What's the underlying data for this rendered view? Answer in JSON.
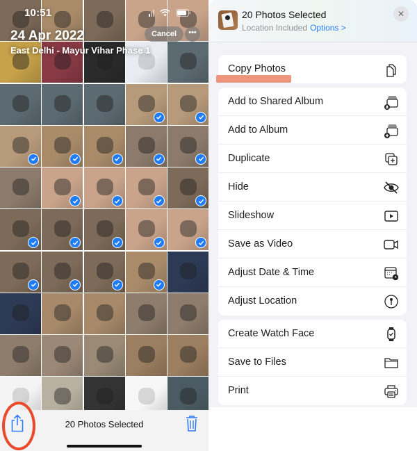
{
  "status_bar": {
    "time": "10:51"
  },
  "photos": {
    "date": "24 Apr 2022",
    "location": "East Delhi - Mayur Vihar Phase 1",
    "cancel_label": "Cancel",
    "more_label": "•••",
    "selected_count_label": "20 Photos Selected",
    "grid": [
      {
        "tone": "wood-dark",
        "selected": false
      },
      {
        "tone": "wood",
        "selected": false
      },
      {
        "tone": "wood-dark",
        "selected": false
      },
      {
        "tone": "hand",
        "selected": false
      },
      {
        "tone": "hand",
        "selected": false
      },
      {
        "tone": "poster",
        "selected": false
      },
      {
        "tone": "boxing",
        "selected": false
      },
      {
        "tone": "dark-text",
        "selected": false
      },
      {
        "tone": "chat",
        "selected": false
      },
      {
        "tone": "hose",
        "selected": false
      },
      {
        "tone": "hose",
        "selected": false
      },
      {
        "tone": "hose",
        "selected": false
      },
      {
        "tone": "hose",
        "selected": false
      },
      {
        "tone": "box-white",
        "selected": true
      },
      {
        "tone": "box-white",
        "selected": true
      },
      {
        "tone": "box-white",
        "selected": true
      },
      {
        "tone": "wood",
        "selected": true
      },
      {
        "tone": "wood",
        "selected": true
      },
      {
        "tone": "case",
        "selected": true
      },
      {
        "tone": "case",
        "selected": true
      },
      {
        "tone": "case",
        "selected": false
      },
      {
        "tone": "hand",
        "selected": true
      },
      {
        "tone": "hand",
        "selected": true
      },
      {
        "tone": "hand",
        "selected": true
      },
      {
        "tone": "wood-dark",
        "selected": true
      },
      {
        "tone": "wood-dark",
        "selected": true
      },
      {
        "tone": "wood-dark",
        "selected": true
      },
      {
        "tone": "wood-dark",
        "selected": true
      },
      {
        "tone": "hand",
        "selected": true
      },
      {
        "tone": "hand",
        "selected": true
      },
      {
        "tone": "wood-dark",
        "selected": true
      },
      {
        "tone": "wood-dark",
        "selected": true
      },
      {
        "tone": "wood-dark",
        "selected": true
      },
      {
        "tone": "wood",
        "selected": true
      },
      {
        "tone": "box-navy",
        "selected": false
      },
      {
        "tone": "box-navy",
        "selected": false
      },
      {
        "tone": "charger",
        "selected": false
      },
      {
        "tone": "charger",
        "selected": false
      },
      {
        "tone": "charger-stand",
        "selected": false
      },
      {
        "tone": "charger-stand",
        "selected": false
      },
      {
        "tone": "charger-stand",
        "selected": false
      },
      {
        "tone": "stand",
        "selected": false
      },
      {
        "tone": "charger-blue",
        "selected": false
      },
      {
        "tone": "phone-edge",
        "selected": false
      },
      {
        "tone": "phone-edge",
        "selected": false
      },
      {
        "tone": "text-doc",
        "selected": false
      },
      {
        "tone": "newspaper",
        "selected": false
      },
      {
        "tone": "meme",
        "selected": false
      },
      {
        "tone": "headline",
        "selected": false
      },
      {
        "tone": "crowd",
        "selected": false
      }
    ],
    "tile_colors": {
      "wood": "#a98b6a",
      "wood-dark": "#7d6a58",
      "hand": "#c9a48b",
      "poster": "#c7a24a",
      "boxing": "#8a3a45",
      "dark-text": "#2b2b2b",
      "chat": "#e9ecf2",
      "hose": "#5c6b72",
      "box-white": "#b79a7a",
      "case": "#8c7b6c",
      "box-navy": "#2d3a55",
      "charger": "#a88a6a",
      "charger-stand": "#8e7d6c",
      "stand": "#9c8877",
      "charger-blue": "#9a8a76",
      "phone-edge": "#9c7e60",
      "text-doc": "#f4f4f4",
      "newspaper": "#b8b0a0",
      "meme": "#333333",
      "headline": "#f7f7f7",
      "crowd": "#4b5b63"
    }
  },
  "share_sheet": {
    "title": "20 Photos Selected",
    "subtitle": "Location Included",
    "options_label": "Options >",
    "close_label": "✕",
    "groups": [
      [
        {
          "label": "Copy Photos",
          "icon": "copy-icon"
        }
      ],
      [
        {
          "label": "Add to Shared Album",
          "icon": "shared-album-icon"
        },
        {
          "label": "Add to Album",
          "icon": "add-album-icon"
        },
        {
          "label": "Duplicate",
          "icon": "duplicate-icon"
        },
        {
          "label": "Hide",
          "icon": "eye-slash-icon"
        },
        {
          "label": "Slideshow",
          "icon": "play-icon"
        },
        {
          "label": "Save as Video",
          "icon": "video-icon"
        },
        {
          "label": "Adjust Date & Time",
          "icon": "calendar-clock-icon"
        },
        {
          "label": "Adjust Location",
          "icon": "location-pin-icon"
        }
      ],
      [
        {
          "label": "Create Watch Face",
          "icon": "watch-icon"
        },
        {
          "label": "Save to Files",
          "icon": "folder-icon"
        },
        {
          "label": "Print",
          "icon": "printer-icon"
        }
      ]
    ]
  },
  "colors": {
    "accent": "#2f7df6",
    "check": "#1f7cf5",
    "annotation": "#e84a2b",
    "highlight": "#ec8a6f"
  }
}
